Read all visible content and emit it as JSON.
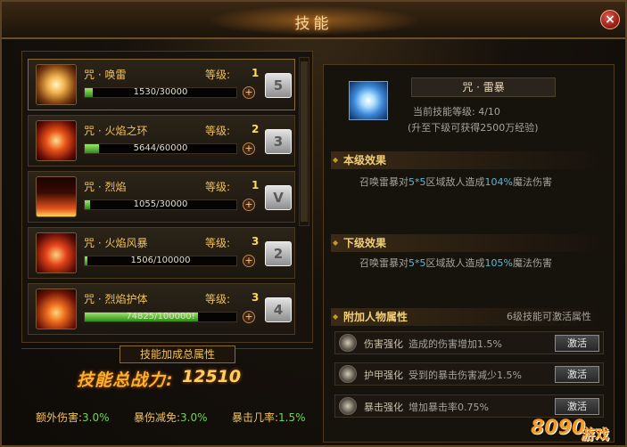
{
  "window": {
    "title": "技能",
    "close_label": "×"
  },
  "skills": [
    {
      "name": "咒 · 唤雷",
      "level_label": "等级:",
      "level": "1",
      "exp": "1530/30000",
      "exp_fraction": 0.05,
      "key": "5"
    },
    {
      "name": "咒 · 火焰之环",
      "level_label": "等级:",
      "level": "2",
      "exp": "5644/60000",
      "exp_fraction": 0.094,
      "key": "3"
    },
    {
      "name": "咒 · 烈焰",
      "level_label": "等级:",
      "level": "1",
      "exp": "1055/30000",
      "exp_fraction": 0.035,
      "key": "V"
    },
    {
      "name": "咒 · 火焰风暴",
      "level_label": "等级:",
      "level": "3",
      "exp": "1506/100000",
      "exp_fraction": 0.015,
      "key": "2"
    },
    {
      "name": "咒 · 烈焰护体",
      "level_label": "等级:",
      "level": "3",
      "exp": "74825/100000!",
      "exp_fraction": 0.748,
      "key": "4"
    }
  ],
  "summary": {
    "header": "技能加成总属性",
    "power_label": "技能总战力:",
    "power_value": "12510",
    "stats": [
      {
        "label": "额外伤害:",
        "value": "3.0%"
      },
      {
        "label": "暴伤减免:",
        "value": "3.0%"
      },
      {
        "label": "暴击几率:",
        "value": "1.5%"
      }
    ]
  },
  "detail": {
    "name": "咒 · 雷暴",
    "current_level": "当前技能等级: 4/10",
    "next_level_note": "(升至下级可获得2500万经验)",
    "this_level_title": "本级效果",
    "this_level_effect": {
      "prefix": "召唤雷暴对",
      "area": "5*5",
      "mid": "区域敌人造成",
      "pct": "104%",
      "suffix": "魔法伤害"
    },
    "next_level_title": "下级效果",
    "next_level_effect": {
      "prefix": "召唤雷暴对",
      "area": "5*5",
      "mid": "区域敌人造成",
      "pct": "105%",
      "suffix": "魔法伤害"
    },
    "attr_title": "附加人物属性",
    "attr_note": "6级技能可激活属性",
    "attributes": [
      {
        "name": "伤害强化",
        "desc": "造成的伤害增加1.5%",
        "button": "激活"
      },
      {
        "name": "护甲强化",
        "desc": "受到的暴击伤害减少1.5%",
        "button": "激活"
      },
      {
        "name": "暴击强化",
        "desc": "增加暴击率0.75%",
        "button": "激活"
      }
    ]
  },
  "watermark": {
    "text1": "8090",
    "text2": "游戏"
  }
}
